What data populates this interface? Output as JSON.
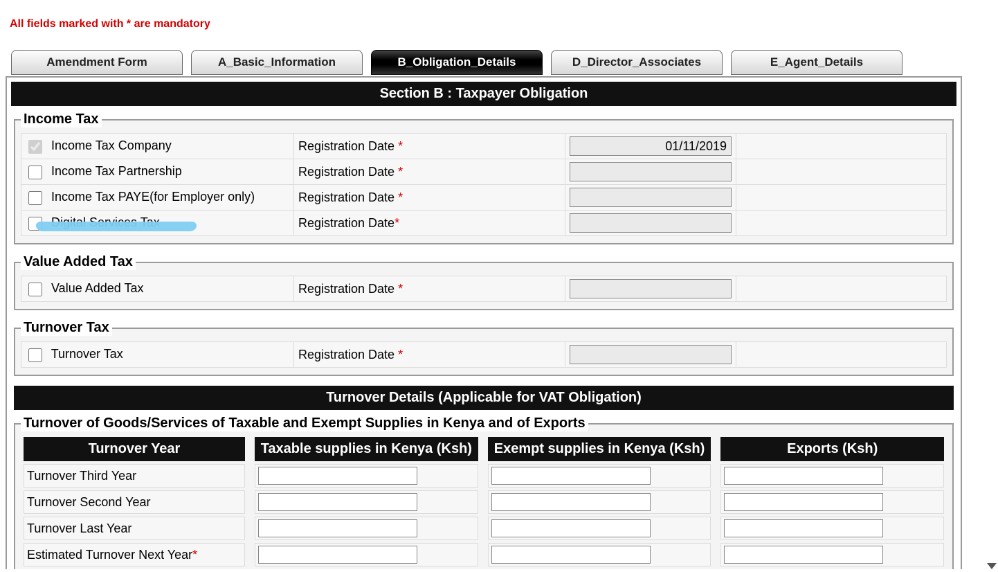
{
  "mandatory_notice": "All fields marked with * are mandatory",
  "tabs": [
    {
      "label": "Amendment Form"
    },
    {
      "label": "A_Basic_Information"
    },
    {
      "label": "B_Obligation_Details"
    },
    {
      "label": "D_Director_Associates"
    },
    {
      "label": "E_Agent_Details"
    }
  ],
  "active_tab_index": 2,
  "section_b": {
    "header": "Section B : Taxpayer Obligation",
    "income_tax": {
      "legend": "Income Tax",
      "rows": [
        {
          "label": "Income Tax Company",
          "reg": "Registration Date ",
          "req": "*",
          "value": "01/11/2019",
          "checked": true,
          "enabled": false
        },
        {
          "label": "Income Tax Partnership",
          "reg": "Registration Date ",
          "req": "*",
          "value": "",
          "checked": false,
          "enabled": true
        },
        {
          "label": "Income Tax PAYE(for Employer only)",
          "reg": "Registration Date ",
          "req": "*",
          "value": "",
          "checked": false,
          "enabled": true
        },
        {
          "label": "Digital Services Tax",
          "reg": "Registration Date",
          "req": "*",
          "value": "",
          "checked": false,
          "enabled": true
        }
      ]
    },
    "vat": {
      "legend": "Value Added Tax",
      "rows": [
        {
          "label": "Value Added Tax",
          "reg": "Registration Date ",
          "req": "*",
          "value": "",
          "checked": false,
          "enabled": true
        }
      ]
    },
    "turnover_tax": {
      "legend": "Turnover Tax",
      "rows": [
        {
          "label": "Turnover Tax",
          "reg": "Registration Date ",
          "req": "*",
          "value": "",
          "checked": false,
          "enabled": true
        }
      ]
    },
    "turnover_details": {
      "header": "Turnover Details (Applicable for VAT Obligation)",
      "legend": "Turnover of Goods/Services of Taxable and Exempt Supplies in Kenya and of Exports",
      "columns": [
        "Turnover Year",
        "Taxable supplies in Kenya (Ksh)",
        "Exempt supplies in Kenya (Ksh)",
        "Exports (Ksh)"
      ],
      "rows": [
        {
          "label": "Turnover Third Year",
          "req": "",
          "taxable": "",
          "exempt": "",
          "exports": ""
        },
        {
          "label": "Turnover Second Year",
          "req": "",
          "taxable": "",
          "exempt": "",
          "exports": ""
        },
        {
          "label": "Turnover Last Year",
          "req": "",
          "taxable": "",
          "exempt": "",
          "exports": ""
        },
        {
          "label": "Estimated Turnover Next Year",
          "req": "*",
          "taxable": "",
          "exempt": "",
          "exports": ""
        }
      ]
    }
  }
}
